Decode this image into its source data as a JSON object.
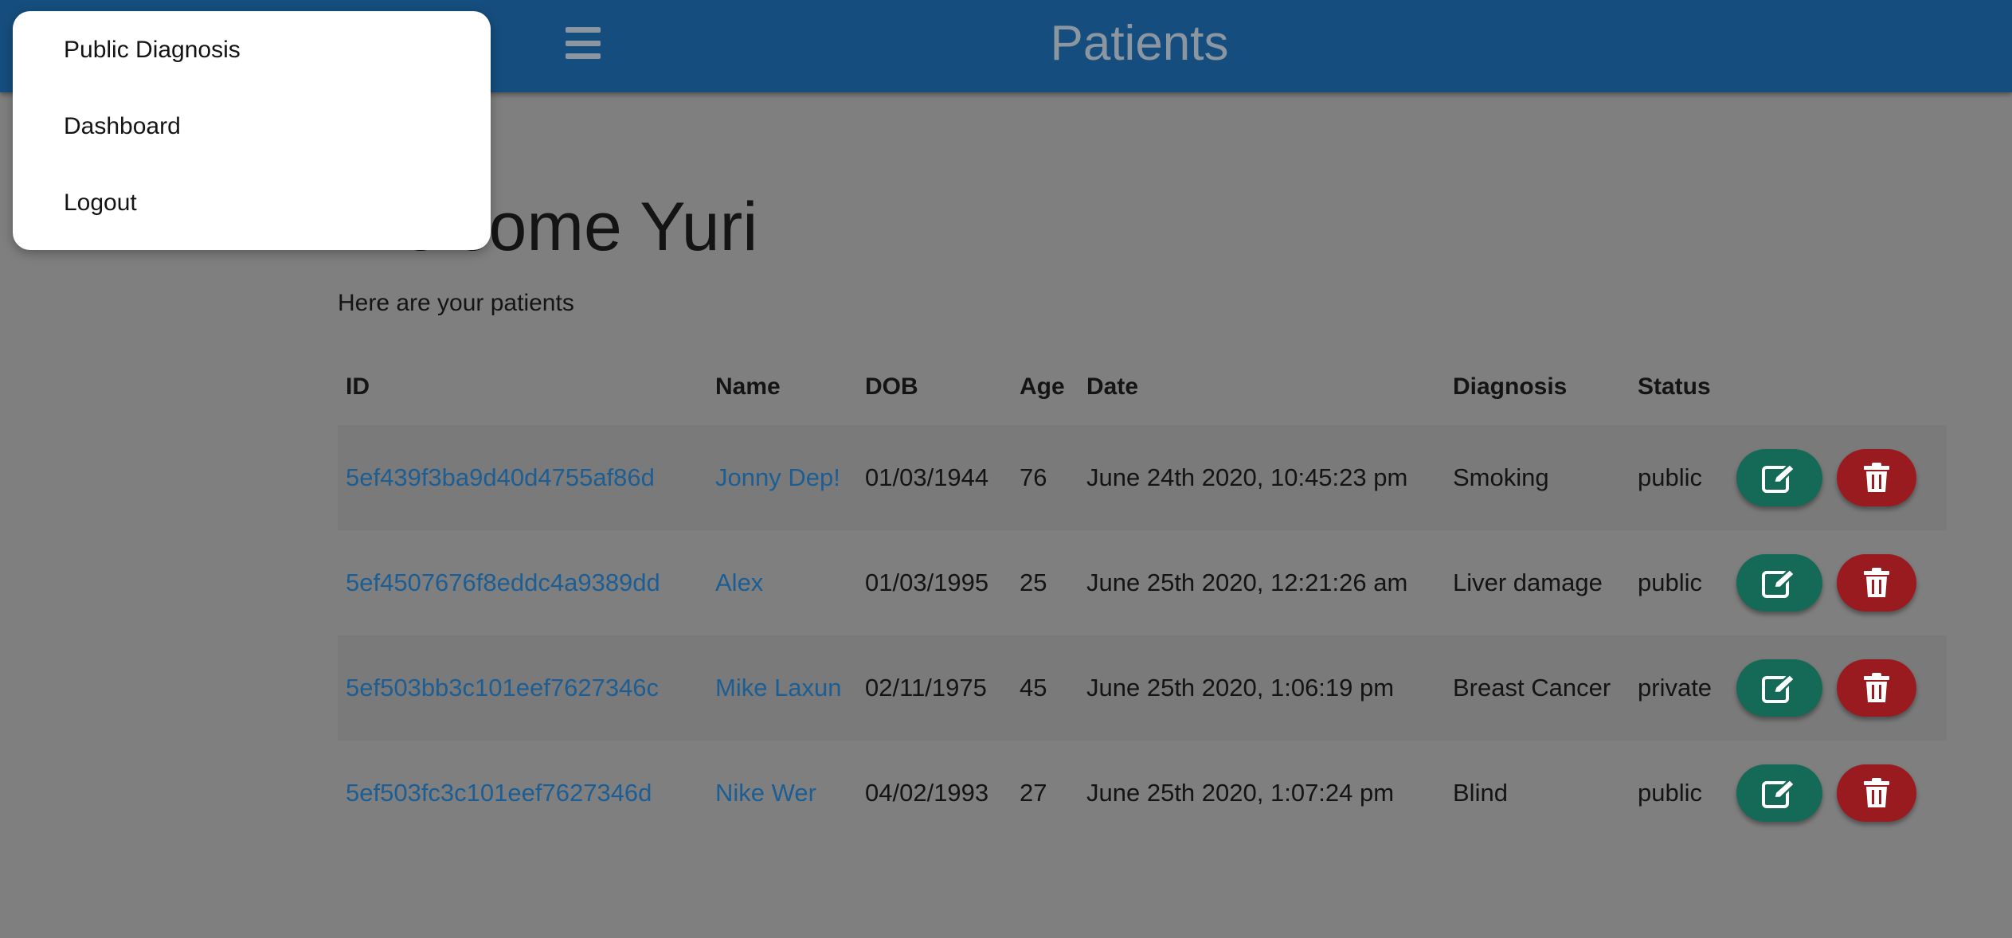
{
  "header": {
    "title": "Patients"
  },
  "menu": {
    "items": [
      "Public Diagnosis",
      "Dashboard",
      "Logout"
    ]
  },
  "main": {
    "welcome": "Welcome Yuri",
    "subtitle": "Here are your patients"
  },
  "table": {
    "headers": [
      "ID",
      "Name",
      "DOB",
      "Age",
      "Date",
      "Diagnosis",
      "Status"
    ],
    "rows": [
      {
        "id": "5ef439f3ba9d40d4755af86d",
        "name": "Jonny Dep!",
        "dob": "01/03/1944",
        "age": "76",
        "date": "June 24th 2020, 10:45:23 pm",
        "diagnosis": "Smoking",
        "status": "public"
      },
      {
        "id": "5ef4507676f8eddc4a9389dd",
        "name": "Alex",
        "dob": "01/03/1995",
        "age": "25",
        "date": "June 25th 2020, 12:21:26 am",
        "diagnosis": "Liver damage",
        "status": "public"
      },
      {
        "id": "5ef503bb3c101eef7627346c",
        "name": "Mike Laxun",
        "dob": "02/11/1975",
        "age": "45",
        "date": "June 25th 2020, 1:06:19 pm",
        "diagnosis": "Breast Cancer",
        "status": "private"
      },
      {
        "id": "5ef503fc3c101eef7627346d",
        "name": "Nike Wer",
        "dob": "04/02/1993",
        "age": "27",
        "date": "June 25th 2020, 1:07:24 pm",
        "diagnosis": "Blind",
        "status": "public"
      }
    ],
    "actions": {
      "edit_icon": "edit-icon",
      "delete_icon": "trash-icon"
    }
  },
  "colors": {
    "header": "#154e7e",
    "link": "#1c5e94",
    "edit_button": "#146a56",
    "delete_button": "#9a1b1f",
    "overlay": "#7f7f7f"
  }
}
